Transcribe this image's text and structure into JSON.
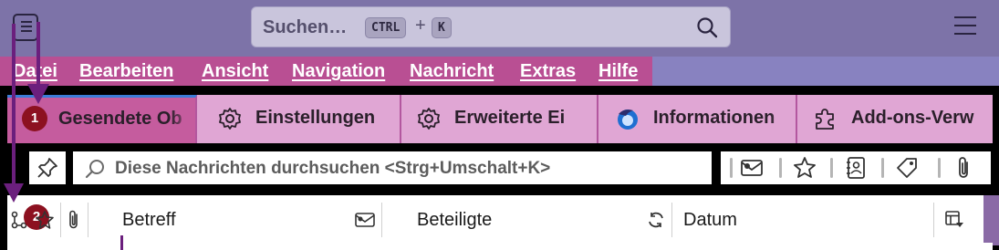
{
  "titlebar": {
    "search": {
      "placeholder": "Suchen…",
      "key1": "CTRL",
      "plus": "+",
      "key2": "K"
    },
    "icons": [
      "app-menu-icon",
      "search-icon",
      "hamburger-menu-icon"
    ]
  },
  "menubar": {
    "items": [
      {
        "label": "Datei"
      },
      {
        "label": "Bearbeiten"
      },
      {
        "label": "Ansicht"
      },
      {
        "label": "Navigation"
      },
      {
        "label": "Nachricht"
      },
      {
        "label": "Extras"
      },
      {
        "label": "Hilfe"
      }
    ]
  },
  "tabs": [
    {
      "label": "Gesendete Ob",
      "icon": "folder-icon",
      "active": true
    },
    {
      "label": "Einstellungen",
      "icon": "gear-icon"
    },
    {
      "label": "Erweiterte Ei",
      "icon": "gear-icon"
    },
    {
      "label": "Informationen",
      "icon": "thunderbird-logo-icon"
    },
    {
      "label": "Add-ons-Verw",
      "icon": "puzzle-icon"
    }
  ],
  "quickfilter": {
    "placeholder": "Diese Nachrichten durchsuchen <Strg+Umschalt+K>",
    "buttons": [
      "contact-icon",
      "star-icon",
      "address-book-icon",
      "tag-icon",
      "attachment-icon"
    ]
  },
  "columns": {
    "subject": "Betreff",
    "participants": "Beteiligte",
    "date": "Datum"
  },
  "annotations": {
    "badge1": "1",
    "badge2": "2"
  },
  "colors": {
    "accent": "#c55c9e",
    "menubar": "#b94f93",
    "titlebar": "#7d73a8",
    "badge": "#8c1120",
    "arrow": "#6b1f7d"
  }
}
